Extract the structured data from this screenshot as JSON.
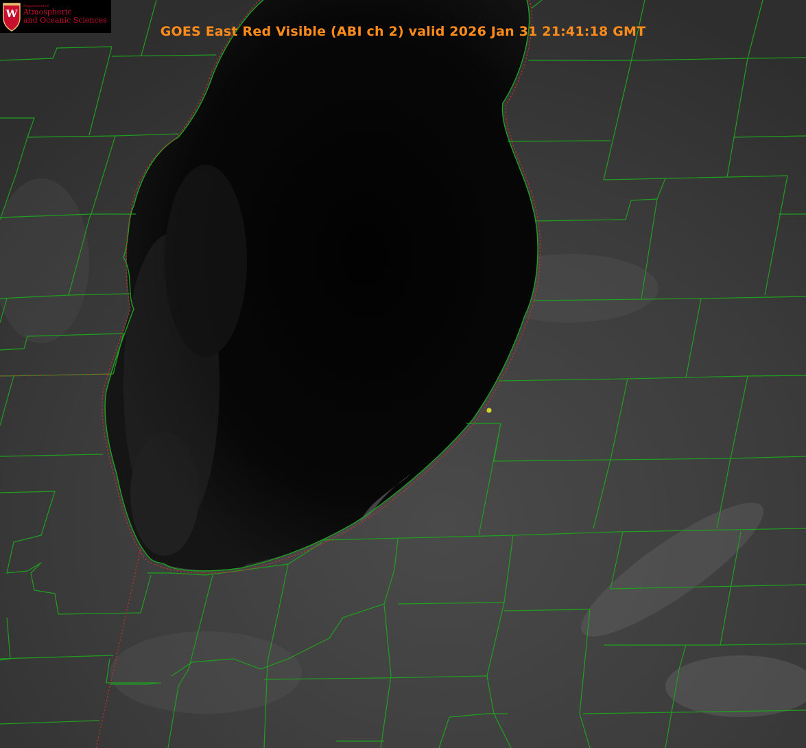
{
  "title": "GOES East Red Visible (ABI ch 2) valid 2026 Jan 31 21:41:18 GMT",
  "logo": {
    "badge_letter": "W",
    "dept": "Department of",
    "line1": "Atmospheric",
    "line2": "and Oceanic Sciences"
  },
  "colors": {
    "title": "#ff8c1a",
    "county_lines": "#1fa01f",
    "state_border": "#d22d2d",
    "marker": "#d4d42a",
    "lake": "#060606",
    "land": "#3a3a3a"
  },
  "map_features": [
    "county-boundaries",
    "state-boundary",
    "lake-michigan-shoreline",
    "location-marker"
  ]
}
